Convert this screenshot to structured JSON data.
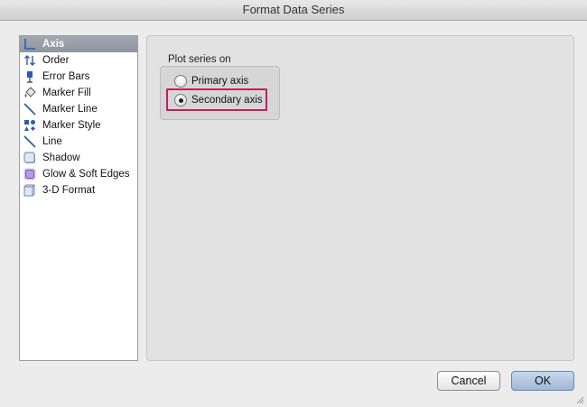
{
  "window": {
    "title": "Format Data Series"
  },
  "sidebar": {
    "items": [
      {
        "label": "Axis",
        "icon": "axis-icon",
        "selected": true
      },
      {
        "label": "Order",
        "icon": "order-icon",
        "selected": false
      },
      {
        "label": "Error Bars",
        "icon": "error-bars-icon",
        "selected": false
      },
      {
        "label": "Marker Fill",
        "icon": "marker-fill-icon",
        "selected": false
      },
      {
        "label": "Marker Line",
        "icon": "marker-line-icon",
        "selected": false
      },
      {
        "label": "Marker Style",
        "icon": "marker-style-icon",
        "selected": false
      },
      {
        "label": "Line",
        "icon": "line-icon",
        "selected": false
      },
      {
        "label": "Shadow",
        "icon": "shadow-icon",
        "selected": false
      },
      {
        "label": "Glow & Soft Edges",
        "icon": "glow-icon",
        "selected": false
      },
      {
        "label": "3-D Format",
        "icon": "3d-format-icon",
        "selected": false
      }
    ]
  },
  "panel": {
    "group_label": "Plot series on",
    "options": [
      {
        "label": "Primary axis",
        "checked": false
      },
      {
        "label": "Secondary axis",
        "checked": true
      }
    ],
    "highlight_color": "#c21f5c"
  },
  "buttons": {
    "cancel": "Cancel",
    "ok": "OK"
  }
}
